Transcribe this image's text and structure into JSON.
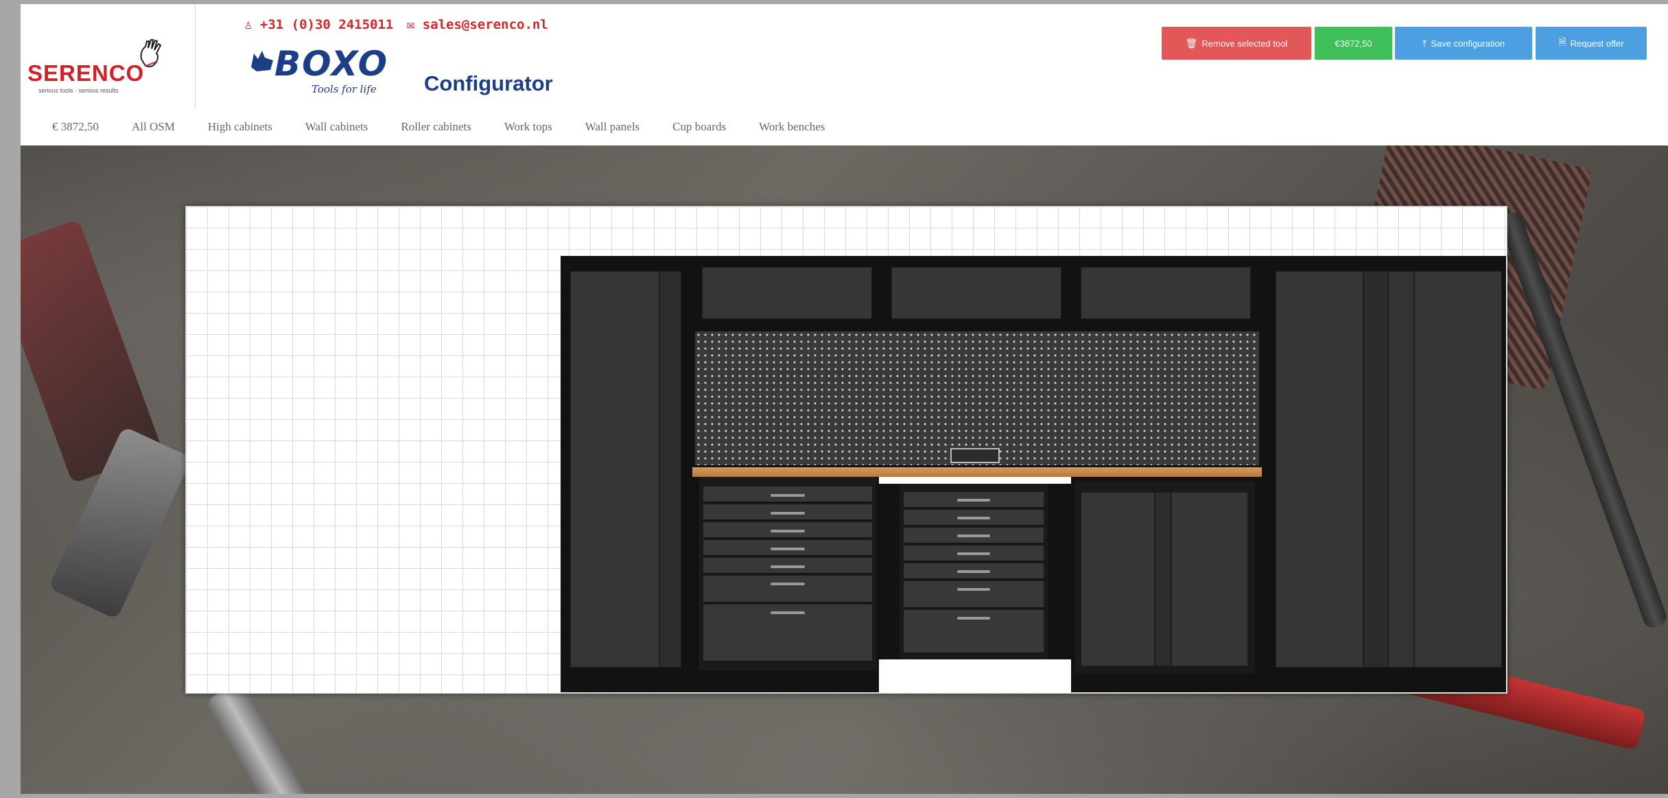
{
  "header": {
    "brand": "SERENCO",
    "brand_tagline": "serious tools · serious results",
    "phone": "+31 (0)30 2415011",
    "email": "sales@serenco.nl",
    "product_logo": "BOXO",
    "product_tagline": "Tools for life",
    "product_title": "Configurator"
  },
  "buttons": {
    "remove": "Remove selected tool",
    "price": "€3872,50",
    "save": "Save configuration",
    "request": "Request offer"
  },
  "nav": {
    "items": [
      "€ 3872,50",
      "All OSM",
      "High cabinets",
      "Wall cabinets",
      "Roller cabinets",
      "Work tops",
      "Wall panels",
      "Cup boards",
      "Work benches"
    ]
  },
  "icons": {
    "user": "user-icon",
    "mail": "envelope-icon",
    "trash": "trash-icon",
    "upload": "upload-icon",
    "document": "document-icon"
  },
  "colors": {
    "brand_red": "#d32027",
    "boxo_blue": "#1c3e86",
    "remove_btn": "#e25757",
    "price_btn": "#3fbf59",
    "action_btn": "#4c9fe0"
  }
}
